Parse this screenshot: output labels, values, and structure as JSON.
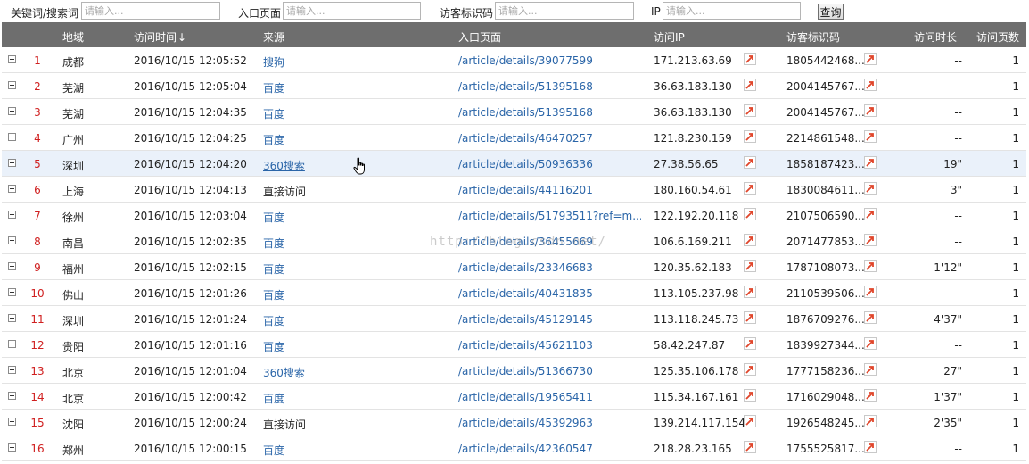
{
  "filters": {
    "keyword_label": "关键词/搜索词",
    "keyword_placeholder": "请输入...",
    "entry_label": "入口页面",
    "entry_placeholder": "请输入...",
    "visitor_label": "访客标识码",
    "visitor_placeholder": "请输入...",
    "ip_label": "IP",
    "ip_placeholder": "请输入...",
    "query_button": "查询"
  },
  "table": {
    "headers": {
      "region": "地域",
      "time": "访问时间",
      "sort_arrow": "🠗",
      "source": "来源",
      "entry_page": "入口页面",
      "ip": "访问IP",
      "visitor_id": "访客标识码",
      "duration": "访问时长",
      "pages": "访问页数"
    },
    "rows": [
      {
        "num": "1",
        "region": "成都",
        "time": "2016/10/15 12:05:52",
        "source": "搜狗",
        "source_link": true,
        "page": "/article/details/39077599",
        "ip": "171.213.63.69",
        "visitor": "1805442468...",
        "duration": "--",
        "pages": "1"
      },
      {
        "num": "2",
        "region": "芜湖",
        "time": "2016/10/15 12:05:04",
        "source": "百度",
        "source_link": true,
        "page": "/article/details/51395168",
        "ip": "36.63.183.130",
        "visitor": "2004145767...",
        "duration": "--",
        "pages": "1"
      },
      {
        "num": "3",
        "region": "芜湖",
        "time": "2016/10/15 12:04:35",
        "source": "百度",
        "source_link": true,
        "page": "/article/details/51395168",
        "ip": "36.63.183.130",
        "visitor": "2004145767...",
        "duration": "--",
        "pages": "1"
      },
      {
        "num": "4",
        "region": "广州",
        "time": "2016/10/15 12:04:25",
        "source": "百度",
        "source_link": true,
        "page": "/article/details/46470257",
        "ip": "121.8.230.159",
        "visitor": "2214861548...",
        "duration": "--",
        "pages": "1"
      },
      {
        "num": "5",
        "region": "深圳",
        "time": "2016/10/15 12:04:20",
        "source": "360搜索",
        "source_link": true,
        "page": "/article/details/50936336",
        "ip": "27.38.56.65",
        "visitor": "1858187423...",
        "duration": "19\"",
        "pages": "1"
      },
      {
        "num": "6",
        "region": "上海",
        "time": "2016/10/15 12:04:13",
        "source": "直接访问",
        "source_link": false,
        "page": "/article/details/44116201",
        "ip": "180.160.54.61",
        "visitor": "1830084611...",
        "duration": "3\"",
        "pages": "1"
      },
      {
        "num": "7",
        "region": "徐州",
        "time": "2016/10/15 12:03:04",
        "source": "百度",
        "source_link": true,
        "page": "/article/details/51793511?ref=m...",
        "ip": "122.192.20.118",
        "visitor": "2107506590...",
        "duration": "--",
        "pages": "1"
      },
      {
        "num": "8",
        "region": "南昌",
        "time": "2016/10/15 12:02:35",
        "source": "百度",
        "source_link": true,
        "page": "/article/details/36455669",
        "ip": "106.6.169.211",
        "visitor": "2071477853...",
        "duration": "--",
        "pages": "1"
      },
      {
        "num": "9",
        "region": "福州",
        "time": "2016/10/15 12:02:15",
        "source": "百度",
        "source_link": true,
        "page": "/article/details/23346683",
        "ip": "120.35.62.183",
        "visitor": "1787108073...",
        "duration": "1'12\"",
        "pages": "1"
      },
      {
        "num": "10",
        "region": "佛山",
        "time": "2016/10/15 12:01:26",
        "source": "百度",
        "source_link": true,
        "page": "/article/details/40431835",
        "ip": "113.105.237.98",
        "visitor": "2110539506...",
        "duration": "--",
        "pages": "1"
      },
      {
        "num": "11",
        "region": "深圳",
        "time": "2016/10/15 12:01:24",
        "source": "百度",
        "source_link": true,
        "page": "/article/details/45129145",
        "ip": "113.118.245.73",
        "visitor": "1876709276...",
        "duration": "4'37\"",
        "pages": "1"
      },
      {
        "num": "12",
        "region": "贵阳",
        "time": "2016/10/15 12:01:16",
        "source": "百度",
        "source_link": true,
        "page": "/article/details/45621103",
        "ip": "58.42.247.87",
        "visitor": "1839927344...",
        "duration": "--",
        "pages": "1"
      },
      {
        "num": "13",
        "region": "北京",
        "time": "2016/10/15 12:01:04",
        "source": "360搜索",
        "source_link": true,
        "page": "/article/details/51366730",
        "ip": "125.35.106.178",
        "visitor": "1777158236...",
        "duration": "27\"",
        "pages": "1"
      },
      {
        "num": "14",
        "region": "北京",
        "time": "2016/10/15 12:00:42",
        "source": "百度",
        "source_link": true,
        "page": "/article/details/19565411",
        "ip": "115.34.167.161",
        "visitor": "1716029048...",
        "duration": "1'37\"",
        "pages": "1"
      },
      {
        "num": "15",
        "region": "沈阳",
        "time": "2016/10/15 12:00:24",
        "source": "直接访问",
        "source_link": false,
        "page": "/article/details/45392963",
        "ip": "139.214.117.154",
        "visitor": "1926548245...",
        "duration": "2'35\"",
        "pages": "1"
      },
      {
        "num": "16",
        "region": "郑州",
        "time": "2016/10/15 12:00:15",
        "source": "百度",
        "source_link": true,
        "page": "/article/details/42360547",
        "ip": "218.28.23.165",
        "visitor": "1755525817...",
        "duration": "--",
        "pages": "1"
      }
    ],
    "highlighted_row": 4
  },
  "watermark": "http://blog.csdn.net/",
  "colors": {
    "header_bg": "#6e6e6e",
    "link": "#2a65a8",
    "row_number": "#d02020",
    "highlight": "#eaf1fa",
    "ext_icon": "#e0452a"
  },
  "icons": {
    "expand": "plus-box-icon",
    "external_link": "external-link-icon",
    "cursor": "hand-pointer-icon"
  }
}
